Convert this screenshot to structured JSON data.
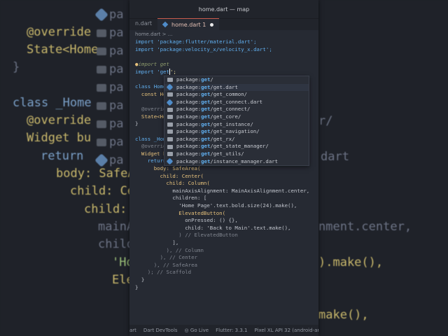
{
  "window": {
    "title": "home.dart — map"
  },
  "tabs": [
    {
      "label": "n.dart"
    },
    {
      "label": "home.dart 1",
      "active": true
    }
  ],
  "breadcrumb": "home.dart > ...",
  "code": {
    "import1": "import 'package:flutter/material.dart';",
    "import2": "import 'package:velocity_x/velocity_x.dart';",
    "hint": "import get",
    "import3_prefix": "import 'get",
    "import3_suffix": "';",
    "class_home": "class Home",
    "const_home": "  const Hom",
    "override1": "  @override",
    "state": "  State<Hom",
    "brace1": "}",
    "class_home2": "class _Home",
    "override2": "  @override",
    "widget": "  Widget bu",
    "return": "    return",
    "body": "      body: SafeArea(",
    "child1": "        child: Center(",
    "child2": "          child: Column(",
    "main_axis": "            mainAxisAlignment: MainAxisAlignment.center,",
    "children": "            children: [",
    "home_page": "              'Home Page'.text.bold.size(24).make(),",
    "elevated": "              ElevatedButton(",
    "onpressed": "                onPressed: () {},",
    "child3": "                child: 'Back to Main'.text.make(),",
    "close_eb": "              ) // ElevatedButton",
    "close_children": "            ],",
    "close_column": "          ), // Column",
    "close_center": "        ), // Center",
    "close_safearea": "      ), // SafeArea",
    "close_scaffold": "    ); // Scaffold",
    "close1": "  }",
    "close2": "}"
  },
  "autocomplete": [
    {
      "icon": "folder",
      "prefix": "package:",
      "match": "get",
      "rest": "/"
    },
    {
      "icon": "dart",
      "prefix": "package:",
      "match": "get",
      "rest": "/get.dart"
    },
    {
      "icon": "folder",
      "prefix": "package:",
      "match": "get",
      "rest": "/get_common/"
    },
    {
      "icon": "dart",
      "prefix": "package:",
      "match": "get",
      "rest": "/get_connect.dart"
    },
    {
      "icon": "folder",
      "prefix": "package:",
      "match": "get",
      "rest": "/get_connect/"
    },
    {
      "icon": "folder",
      "prefix": "package:",
      "match": "get",
      "rest": "/get_core/"
    },
    {
      "icon": "folder",
      "prefix": "package:",
      "match": "get",
      "rest": "/get_instance/"
    },
    {
      "icon": "folder",
      "prefix": "package:",
      "match": "get",
      "rest": "/get_navigation/"
    },
    {
      "icon": "folder",
      "prefix": "package:",
      "match": "get",
      "rest": "/get_rx/"
    },
    {
      "icon": "folder",
      "prefix": "package:",
      "match": "get",
      "rest": "/get_state_manager/"
    },
    {
      "icon": "folder",
      "prefix": "package:",
      "match": "get",
      "rest": "/get_utils/"
    },
    {
      "icon": "dart",
      "prefix": "package:",
      "match": "get",
      "rest": "/instance_manager.dart"
    }
  ],
  "statusbar": {
    "item1": "art",
    "devtools": "Dart DevTools",
    "golive": "Go Live",
    "flutter": "Flutter: 3.3.1",
    "device": "Pixel XL API 32 (android-arm"
  },
  "background": {
    "l1": "@override",
    "l2": "State<Home",
    "l3": "}",
    "l4": "class _Home",
    "l5": "@override",
    "l6": "Widget bu",
    "l7": "return",
    "l8": "body: SafeAre",
    "l9": "child: Ce",
    "l10": "child:",
    "l11": "mainA",
    "l12": "child",
    "l13": "'Ho",
    "l14": "Ele",
    "r1": "r/",
    "r2": "dart",
    "r3": "nment.center,",
    "r4": ").make(),",
    "r5": "make(),",
    "side": "pa"
  }
}
